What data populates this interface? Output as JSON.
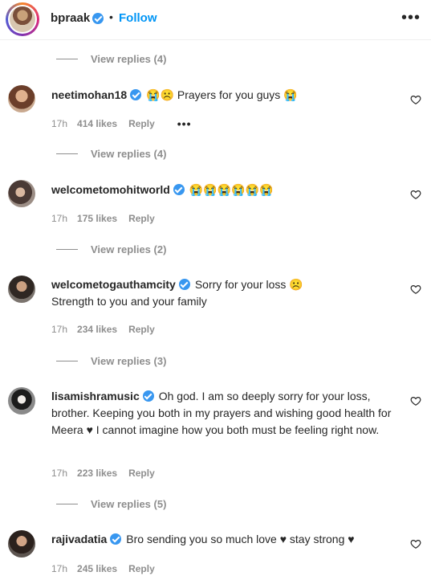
{
  "header": {
    "username": "bpraak",
    "dot": "•",
    "follow_label": "Follow",
    "more_label": "•••"
  },
  "comments": [
    {
      "replies_label_before": "View replies (4)"
    },
    {
      "username": "neetimohan18",
      "text": "😭☹️ Prayers for you guys 😭",
      "time": "17h",
      "likes": "414 likes",
      "reply_label": "Reply",
      "more_label": "•••",
      "replies_label": "View replies (4)"
    },
    {
      "username": "welcometomohitworld",
      "text": "😭😭😭😭😭😭",
      "time": "17h",
      "likes": "175 likes",
      "reply_label": "Reply",
      "replies_label": "View replies (2)"
    },
    {
      "username": "welcometogauthamcity",
      "text": "Sorry for your loss ☹️",
      "text2": "Strength to you and your family",
      "time": "17h",
      "likes": "234 likes",
      "reply_label": "Reply",
      "replies_label": "View replies (3)"
    },
    {
      "username": "lisamishramusic",
      "text": "Oh god. I am so deeply sorry for your loss, brother. Keeping you both in my prayers and wishing good health for Meera ♥ I cannot imagine how you both must be feeling right now.",
      "time": "17h",
      "likes": "223 likes",
      "reply_label": "Reply",
      "replies_label": "View replies (5)"
    },
    {
      "username": "rajivadatia",
      "text": "Bro sending you so much love ♥ stay strong ♥",
      "time": "17h",
      "likes": "245 likes",
      "reply_label": "Reply"
    }
  ]
}
